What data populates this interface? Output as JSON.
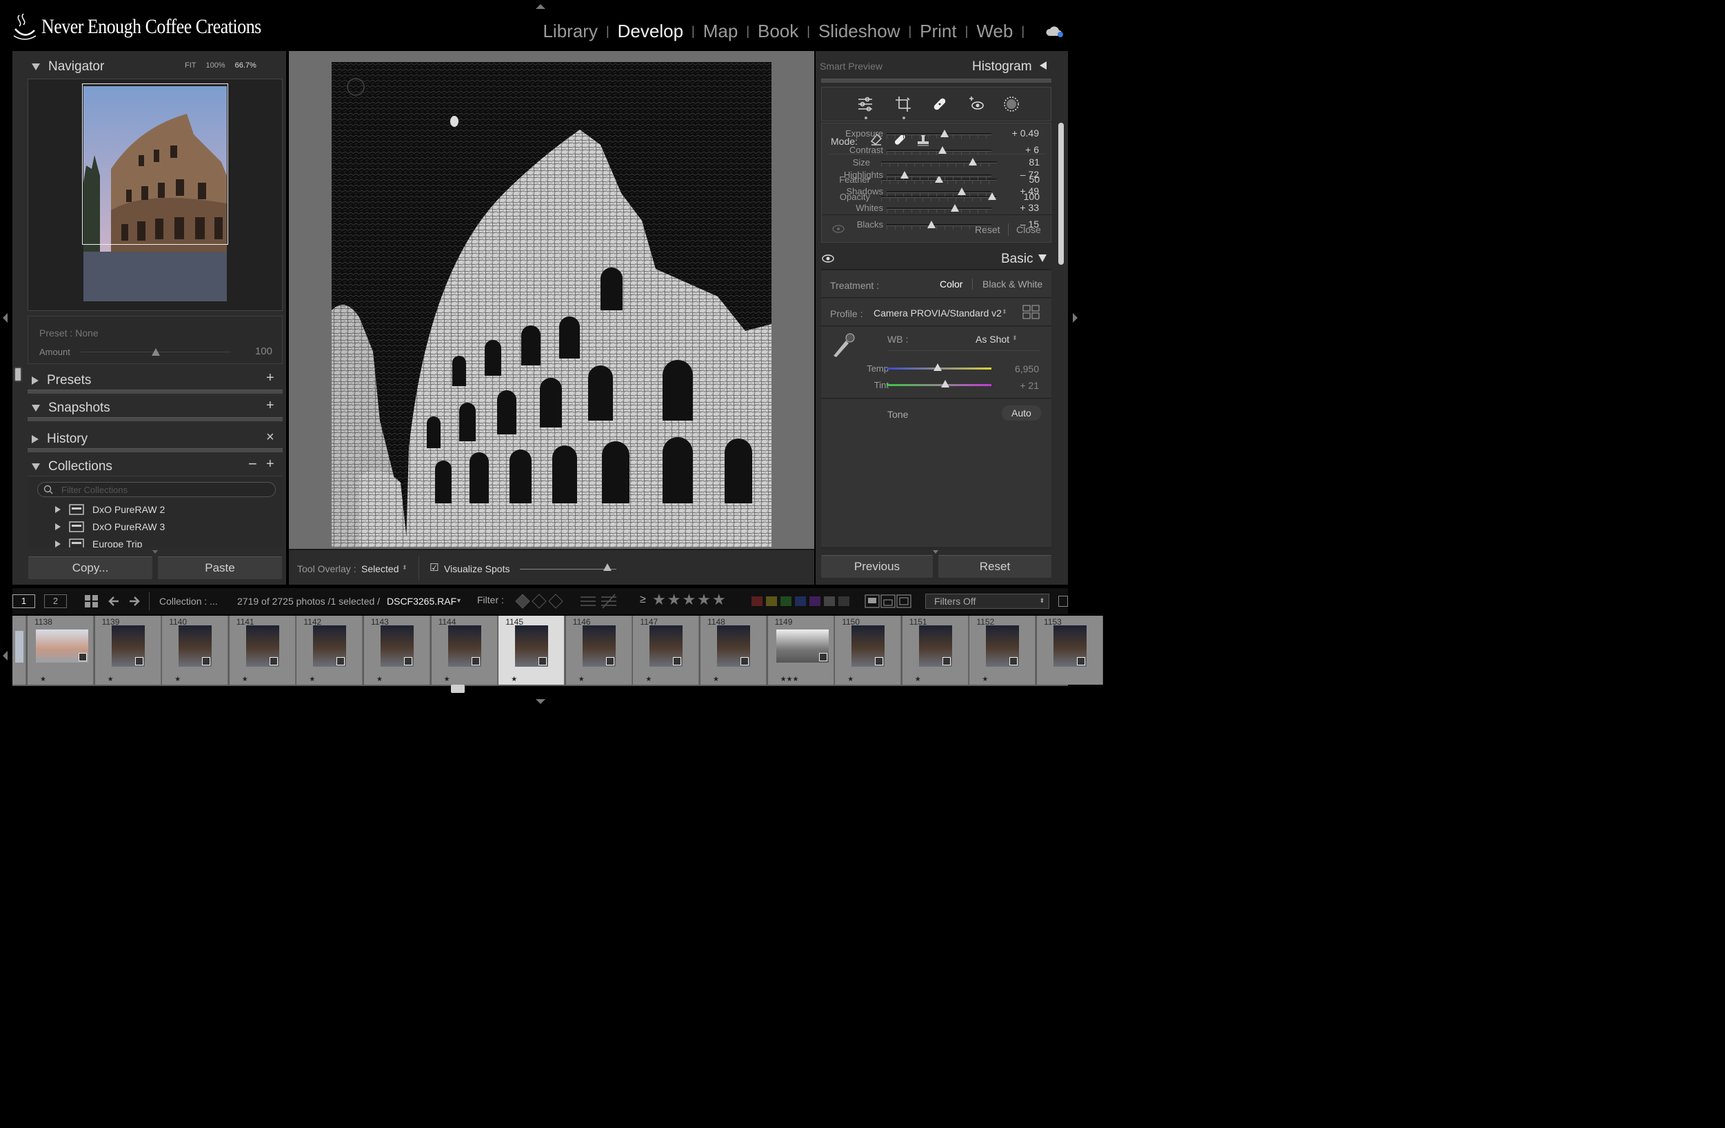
{
  "app": {
    "brand": "Never Enough Coffee Creations",
    "module_separator": "|"
  },
  "modules": [
    "Library",
    "Develop",
    "Map",
    "Book",
    "Slideshow",
    "Print",
    "Web"
  ],
  "active_module": "Develop",
  "navigator": {
    "title": "Navigator",
    "zoom_options": [
      "FIT",
      "100%",
      "66.7%"
    ],
    "preset_label": "Preset : None",
    "amount_label": "Amount",
    "amount_value": "100"
  },
  "left_sections": [
    {
      "title": "Presets",
      "action": "+"
    },
    {
      "title": "Snapshots",
      "action": "+"
    },
    {
      "title": "History",
      "action": "×"
    },
    {
      "title": "Collections",
      "action": "+"
    }
  ],
  "collections": {
    "filter_placeholder": "Filter Collections",
    "items": [
      "DxO PureRAW 2",
      "DxO PureRAW 3",
      "Europe Trip"
    ]
  },
  "left_buttons": {
    "copy": "Copy...",
    "paste": "Paste"
  },
  "toolbar": {
    "tool_overlay_label": "Tool Overlay :",
    "tool_overlay_value": "Selected",
    "visualize_spots": "Visualize Spots",
    "visualize_checked": true,
    "visualize_level": 0.9
  },
  "right": {
    "smart_preview": "Smart Preview",
    "histogram": "Histogram",
    "mode_label": "Mode:",
    "brush": [
      {
        "label": "Size",
        "value": "81",
        "pos": 0.79
      },
      {
        "label": "Feather",
        "value": "50",
        "pos": 0.5
      },
      {
        "label": "Opacity",
        "value": "100",
        "pos": 0.96
      }
    ],
    "reset": "Reset",
    "close": "Close",
    "basic": "Basic",
    "treatment_label": "Treatment :",
    "treatment_color": "Color",
    "treatment_bw": "Black & White",
    "profile_label": "Profile :",
    "profile_value": "Camera PROVIA/Standard v2",
    "wb_label": "WB :",
    "wb_value": "As Shot",
    "temp": {
      "label": "Temp",
      "value": "6,950",
      "pos": 0.49
    },
    "tint": {
      "label": "Tint",
      "value": "+ 21",
      "pos": 0.56
    },
    "tone": "Tone",
    "auto": "Auto",
    "tone_sliders": [
      {
        "label": "Exposure",
        "value": "+ 0.49",
        "pos": 0.55
      },
      {
        "label": "Contrast",
        "value": "+ 6",
        "pos": 0.53
      },
      {
        "label": "Highlights",
        "value": "– 72",
        "pos": 0.17
      },
      {
        "label": "Shadows",
        "value": "+ 49",
        "pos": 0.72
      },
      {
        "label": "Whites",
        "value": "+ 33",
        "pos": 0.65
      },
      {
        "label": "Blacks",
        "value": "– 15",
        "pos": 0.43
      }
    ],
    "previous": "Previous",
    "reset_btn": "Reset"
  },
  "filmbar": {
    "view1": "1",
    "view2": "2",
    "collection": "Collection : ...",
    "count": "2719 of 2725 photos /1 selected /",
    "filename": "DSCF3265.RAF",
    "filter_label": "Filter :",
    "gte": "≥",
    "filters_off": "Filters Off"
  },
  "film_frames": [
    {
      "num": "1138",
      "stars": "★"
    },
    {
      "num": "1139",
      "stars": "★"
    },
    {
      "num": "1140",
      "stars": "★"
    },
    {
      "num": "1141",
      "stars": "★"
    },
    {
      "num": "1142",
      "stars": "★"
    },
    {
      "num": "1143",
      "stars": "★"
    },
    {
      "num": "1144",
      "stars": "★"
    },
    {
      "num": "1145",
      "stars": "★"
    },
    {
      "num": "1146",
      "stars": "★"
    },
    {
      "num": "1147",
      "stars": "★"
    },
    {
      "num": "1148",
      "stars": "★"
    },
    {
      "num": "1149",
      "stars": "★★★"
    },
    {
      "num": "1150",
      "stars": "★"
    },
    {
      "num": "1151",
      "stars": "★"
    },
    {
      "num": "1152",
      "stars": "★"
    },
    {
      "num": "1153",
      "stars": ""
    }
  ],
  "selected_frame": "1145",
  "colors": {
    "panel": "#2c2c2c",
    "active": "#f2f2f2",
    "inactive": "#9a9a9a",
    "temp_start": "#3b4bd1",
    "temp_end": "#d8d23a",
    "tint_start": "#3ec447",
    "tint_end": "#c23ad4"
  }
}
